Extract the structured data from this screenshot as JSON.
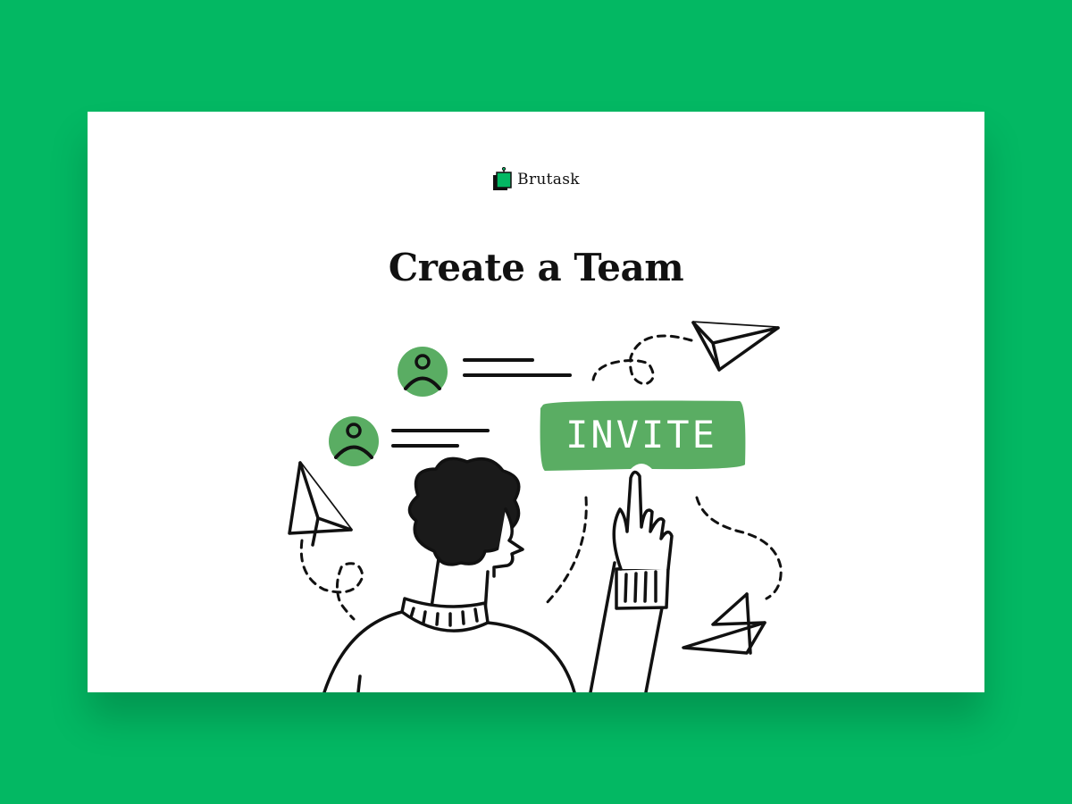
{
  "brand": {
    "name": "Brutask",
    "logo_icon": "brutask-logo-icon"
  },
  "page": {
    "title": "Create a Team"
  },
  "illustration": {
    "invite_label": "INVITE"
  },
  "colors": {
    "background": "#03b863",
    "card": "#ffffff",
    "accent_green": "#5aad63",
    "ink": "#111111"
  }
}
